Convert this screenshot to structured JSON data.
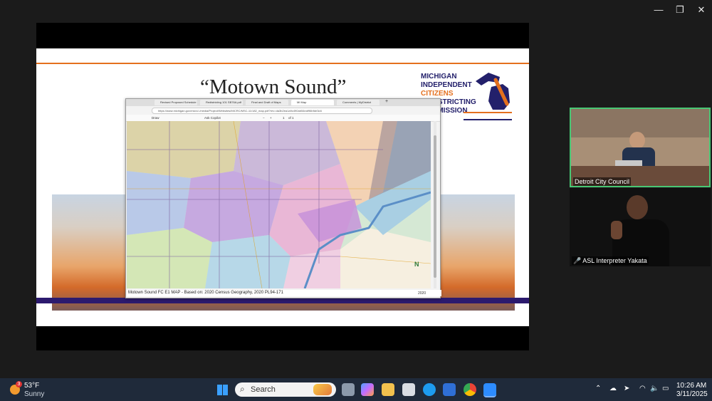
{
  "window_controls": {
    "minimize": "—",
    "restore": "❐",
    "close": "✕"
  },
  "slide": {
    "title": "“Motown Sound”",
    "logo": {
      "line1": "MICHIGAN",
      "line2": "INDEPENDENT",
      "line3": "CITIZENS",
      "line4": "REDISTRICTING",
      "line5": "COMMISSION"
    }
  },
  "browser": {
    "tabs": [
      "Revised Proposed Schedule for",
      "Redistricting 101 SB76A.pdf",
      "Final and Draft of Maps",
      "MI Map",
      "Comments | MyDistrict"
    ],
    "active_tab_index": 3,
    "new_tab": "+",
    "address": "https://www.michigan.gov/micrc/-/media/Project/Websites/MICRC/MSC-11/182_map.pdf?rev=da3b2ea1a9c490ab54eaf96bfde3d4",
    "pdf_toolbar": {
      "draw": "Draw",
      "ask_copilot": "Ask Copilot",
      "minus": "−",
      "plus": "+",
      "page": "1",
      "of_pages": "of 1"
    },
    "map_caption": "Motown Sound FC E1 MAP - Based on:  2020 Census Geography, 2020 PL94-171",
    "map_footer_year": "2020",
    "compass_label": "N"
  },
  "participants": [
    {
      "name": "Detroit City Council",
      "active_speaker": true
    },
    {
      "name": "ASL Interpreter Yakata",
      "muted": true
    }
  ],
  "taskbar": {
    "weather": {
      "badge": "3",
      "temp": "53°F",
      "condition": "Sunny"
    },
    "search_placeholder": "Search",
    "time": "10:26 AM",
    "date": "3/11/2025"
  },
  "colors": {
    "accent_orange": "#e4701e",
    "logo_navy": "#23206b",
    "active_speaker_border": "#48c774",
    "taskbar": "#1f2a3a"
  }
}
